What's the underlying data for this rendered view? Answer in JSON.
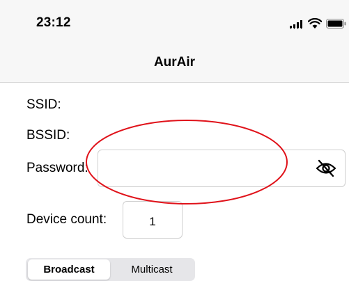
{
  "status_bar": {
    "time": "23:12",
    "icons": [
      "signal-icon",
      "wifi-icon",
      "battery-icon"
    ]
  },
  "nav": {
    "title": "AurAir"
  },
  "form": {
    "ssid_label": "SSID:",
    "bssid_label": "BSSID:",
    "password_label": "Password:",
    "password_value": "",
    "device_count_label": "Device count:",
    "device_count_value": "1"
  },
  "mode": {
    "options": [
      "Broadcast",
      "Multicast"
    ],
    "selected": "Broadcast"
  },
  "colors": {
    "annotation": "#e0121a",
    "bar_background": "#f7f7f7"
  }
}
